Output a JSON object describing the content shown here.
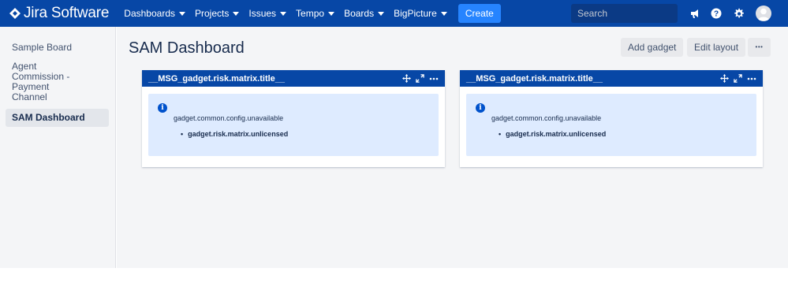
{
  "app": {
    "logo_text": "Jira Software"
  },
  "nav": {
    "items": [
      {
        "label": "Dashboards"
      },
      {
        "label": "Projects"
      },
      {
        "label": "Issues"
      },
      {
        "label": "Tempo"
      },
      {
        "label": "Boards"
      },
      {
        "label": "BigPicture"
      }
    ],
    "create_label": "Create",
    "search_placeholder": "Search"
  },
  "icons": {
    "search": "search-icon",
    "notifications": "megaphone-icon",
    "help": "help-icon",
    "settings": "gear-icon",
    "profile": "avatar"
  },
  "sidebar": {
    "items": [
      {
        "label": "Sample Board"
      },
      {
        "label": "Agent Commission - Payment Channel"
      },
      {
        "label": "SAM Dashboard",
        "active": true
      }
    ]
  },
  "main": {
    "title": "SAM Dashboard",
    "add_gadget_label": "Add gadget",
    "edit_layout_label": "Edit layout",
    "more_label": "•••"
  },
  "gadgets": [
    {
      "title": "__MSG_gadget.risk.matrix.title__",
      "message": "gadget.common.config.unavailable",
      "bullet": "gadget.risk.matrix.unlicensed"
    },
    {
      "title": "__MSG_gadget.risk.matrix.title__",
      "message": "gadget.common.config.unavailable",
      "bullet": "gadget.risk.matrix.unlicensed"
    }
  ],
  "colors": {
    "brand": "#0747a6",
    "create": "#2684ff",
    "info_bg": "#deebff",
    "info_icon": "#0052cc"
  }
}
